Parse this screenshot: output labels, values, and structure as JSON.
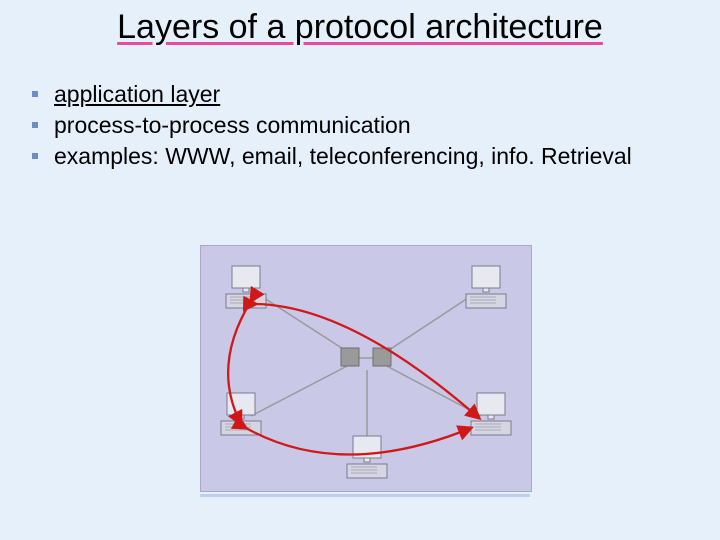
{
  "title": "Layers of a protocol architecture",
  "bullets": [
    "application layer",
    "process-to-process communication",
    "examples: WWW, email, teleconferencing, info. Retrieval"
  ]
}
